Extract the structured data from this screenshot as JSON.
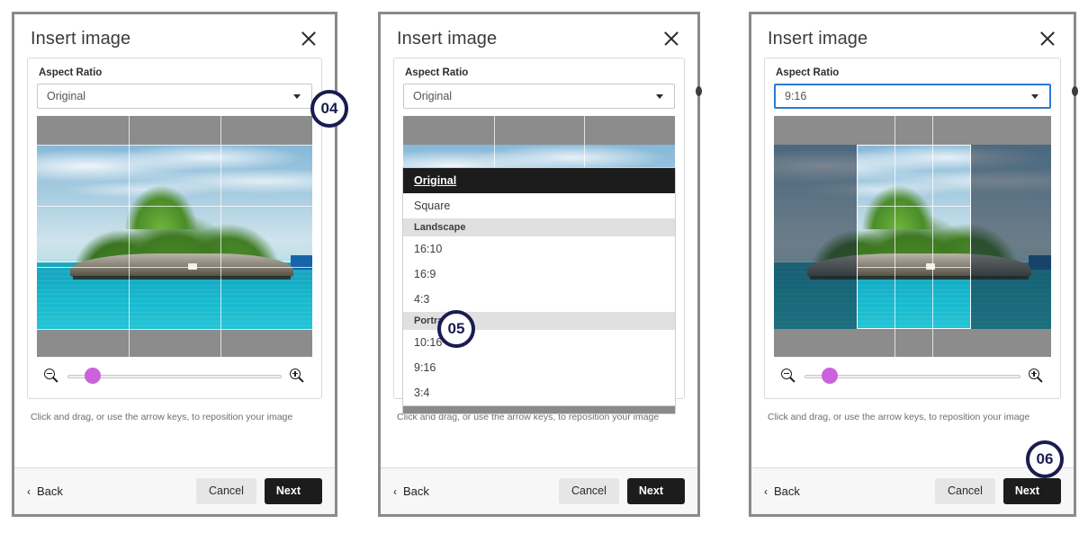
{
  "dialog": {
    "title": "Insert image",
    "close_icon": "close-icon",
    "aspect_label": "Aspect Ratio",
    "hint": "Click and drag, or use the arrow keys, to reposition your image",
    "back_label": "Back",
    "cancel_label": "Cancel",
    "next_label": "Next",
    "back_chevron": "‹",
    "next_chevron": "›",
    "caret_icon": "chevron-down-icon",
    "zoom_out_icon": "zoom-out-icon",
    "zoom_in_icon": "zoom-in-icon"
  },
  "panels": [
    {
      "id": "panel-1",
      "aspect_value": "Original",
      "focused": false,
      "dropdown_open": false
    },
    {
      "id": "panel-2",
      "aspect_value": "Original",
      "focused": false,
      "dropdown_open": true
    },
    {
      "id": "panel-3",
      "aspect_value": "9:16",
      "focused": true,
      "dropdown_open": false
    }
  ],
  "aspect_options": [
    {
      "label": "Original",
      "type": "option",
      "selected": true
    },
    {
      "label": "Square",
      "type": "option",
      "selected": false
    },
    {
      "label": "Landscape",
      "type": "group",
      "selected": false
    },
    {
      "label": "16:10",
      "type": "option",
      "selected": false
    },
    {
      "label": "16:9",
      "type": "option",
      "selected": false
    },
    {
      "label": "4:3",
      "type": "option",
      "selected": false
    },
    {
      "label": "Portrait",
      "type": "group",
      "selected": false
    },
    {
      "label": "10:16",
      "type": "option",
      "selected": false
    },
    {
      "label": "9:16",
      "type": "option",
      "selected": false
    },
    {
      "label": "3:4",
      "type": "option",
      "selected": false
    }
  ],
  "zoom_slider": {
    "value_percent": 8,
    "thumb_color": "#cb62dc"
  },
  "callouts": [
    {
      "id": "badge-04",
      "label": "04"
    },
    {
      "id": "badge-05",
      "label": "05"
    },
    {
      "id": "badge-06",
      "label": "06"
    }
  ]
}
